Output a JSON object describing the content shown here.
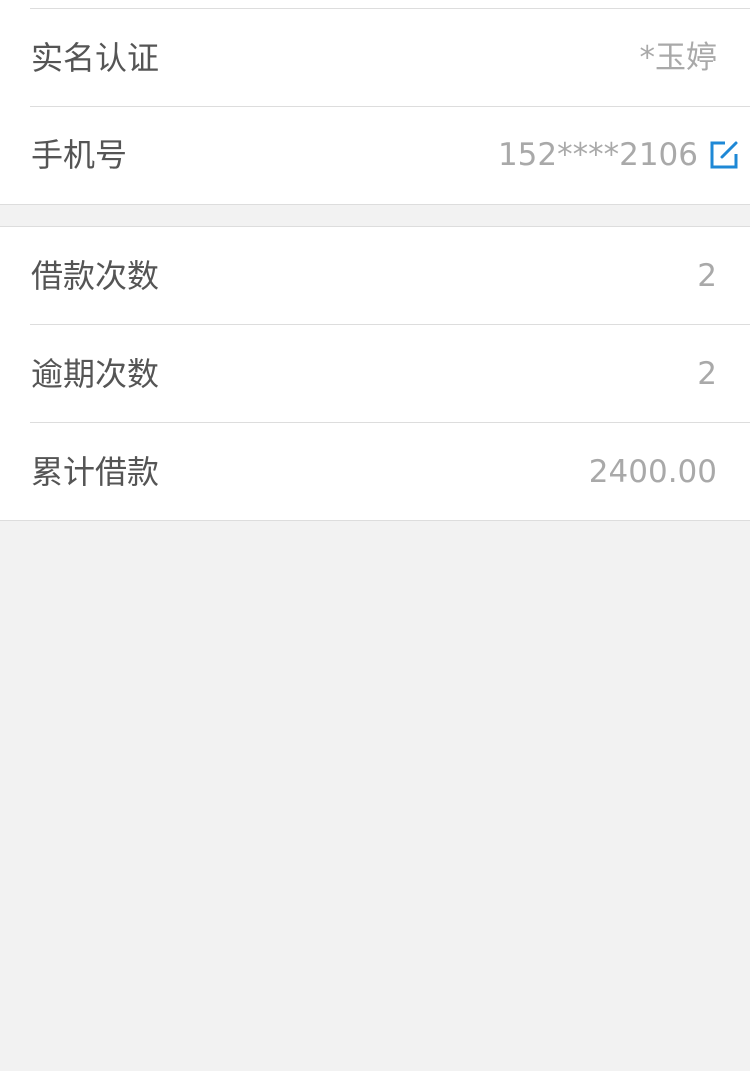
{
  "profile": {
    "real_name": {
      "label": "实名认证",
      "value": "*玉婷"
    },
    "phone": {
      "label": "手机号",
      "value": "152****2106",
      "icon": "edit-icon"
    }
  },
  "stats": {
    "loan_count": {
      "label": "借款次数",
      "value": "2"
    },
    "overdue_count": {
      "label": "逾期次数",
      "value": "2"
    },
    "total_loan": {
      "label": "累计借款",
      "value": "2400.00"
    }
  },
  "colors": {
    "background": "#f2f2f2",
    "card": "#ffffff",
    "divider": "#dddddd",
    "label_text": "#555555",
    "value_text": "#a9a9a9",
    "accent": "#1e88d6"
  }
}
